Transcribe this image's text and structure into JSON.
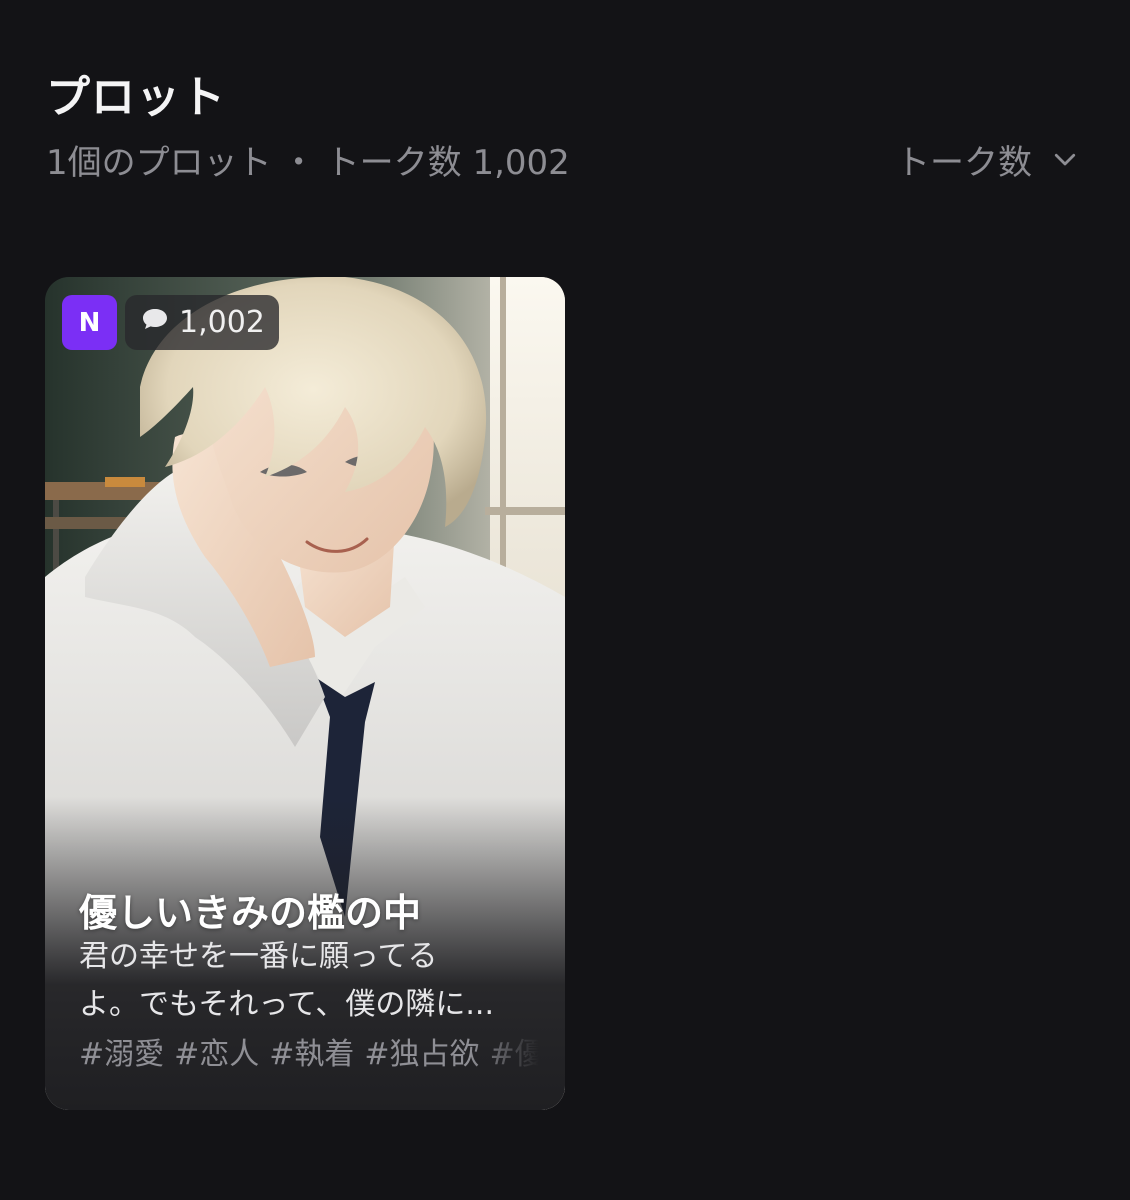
{
  "header": {
    "title": "プロット",
    "count_text": "1個のプロット",
    "separator": "・",
    "talk_count_text": "トーク数 1,002",
    "sort_label": "トーク数"
  },
  "cards": [
    {
      "badge": "N",
      "talk_count": "1,002",
      "title": "優しいきみの檻の中",
      "description_lines": [
        "君の幸せを一番に願ってる",
        "よ。でもそれって、僕の隣に..."
      ],
      "tags": [
        "#溺愛",
        "#恋人",
        "#執着",
        "#独占欲",
        "#優"
      ],
      "badge_color": "#7b2ff5"
    }
  ],
  "colors": {
    "background": "#131316",
    "muted_text": "#8d8d93",
    "accent": "#7b2ff5"
  },
  "icons": {
    "sort": "chevron-down-icon",
    "talk": "speech-bubble-icon"
  }
}
